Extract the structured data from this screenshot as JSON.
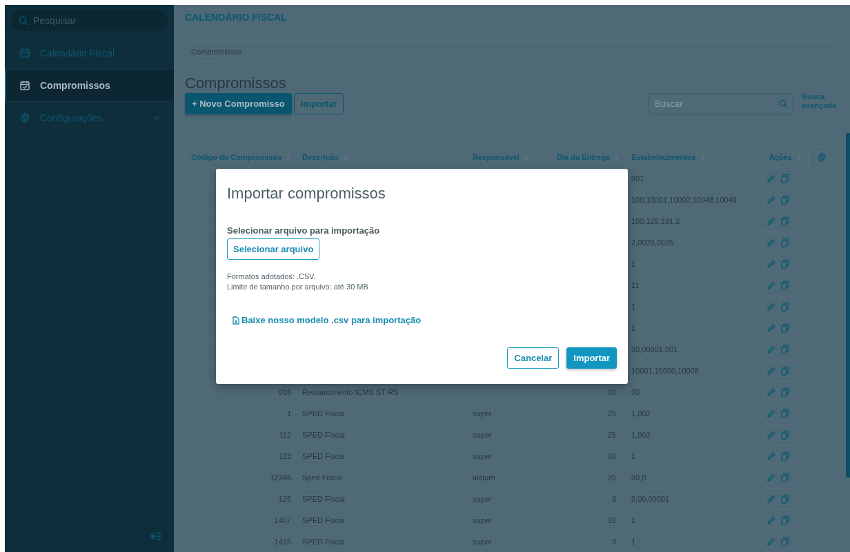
{
  "sidebar": {
    "search": {
      "placeholder": "Pesquisar"
    },
    "items": [
      {
        "label": "Calendário Fiscal",
        "kind": "link",
        "selected": false
      },
      {
        "label": "Compromissos",
        "kind": "link",
        "selected": true
      },
      {
        "label": "Configurações",
        "kind": "group",
        "selected": false,
        "expanded": false
      }
    ]
  },
  "header": {
    "title": "CALENDÁRIO FISCAL"
  },
  "breadcrumb": [
    "Compromissos"
  ],
  "page_title": "Compromissos",
  "actions": [
    {
      "label": "+ Novo Compromisso",
      "kind": "primary"
    },
    {
      "label": "Importar",
      "kind": "secondary"
    }
  ],
  "search": {
    "placeholder": "Buscar",
    "advanced_link": "Busca avançada"
  },
  "table": {
    "columns": [
      {
        "label": "Código do Compromisso"
      },
      {
        "label": "Descrição"
      },
      {
        "label": "Responsável"
      },
      {
        "label": "Dia da Entrega"
      },
      {
        "label": "Estabelecimentos"
      },
      {
        "label": "Ações"
      }
    ],
    "rows": [
      {
        "establishments": "001"
      },
      {
        "establishments": "100,10001,10002,10048,10049"
      },
      {
        "establishments": "100,125,181,2"
      },
      {
        "establishments": "2,0020,0025"
      },
      {
        "establishments": "1"
      },
      {
        "establishments": "11"
      },
      {
        "establishments": "1"
      },
      {
        "establishments": "1"
      },
      {
        "establishments": "00,00001,001"
      },
      {
        "establishments": "10001,10000,10008"
      },
      {
        "code": "016",
        "description": "Ressarcimento ICMS ST RS",
        "responsible": "",
        "day": "10",
        "establishments": "00"
      },
      {
        "code": "1",
        "description": "SPED Fiscal",
        "responsible": "super",
        "day": "25",
        "establishments": "1,002"
      },
      {
        "code": "112",
        "description": "SPED Fiscal",
        "responsible": "super",
        "day": "25",
        "establishments": "1,002"
      },
      {
        "code": "123",
        "description": "SPED Fiscal",
        "responsible": "super",
        "day": "10",
        "establishments": "1"
      },
      {
        "code": "12345",
        "description": "Sped Fiscal",
        "responsible": "alalum",
        "day": "20",
        "establishments": "00,0"
      },
      {
        "code": "125",
        "description": "SPED Fiscal",
        "responsible": "super",
        "day": "3",
        "establishments": "0,00,00001"
      },
      {
        "code": "1407",
        "description": "SPED Fiscal",
        "responsible": "super",
        "day": "15",
        "establishments": "1"
      },
      {
        "code": "1415",
        "description": "SPED Fiscal",
        "responsible": "super",
        "day": "3",
        "establishments": "1"
      }
    ]
  },
  "dialog": {
    "title": "Importar compromissos",
    "field_label": "Selecionar arquivo para importação",
    "file_button": "Selecionar arquivo",
    "hints": [
      "Formatos adotados: .CSV.",
      "Limite de tamanho por arquivo: até 30 MB"
    ],
    "download_link": "Baixe nosso modelo .csv para importação",
    "buttons": [
      {
        "label": "Cancelar",
        "kind": "secondary"
      },
      {
        "label": "Importar",
        "kind": "primary"
      }
    ]
  }
}
